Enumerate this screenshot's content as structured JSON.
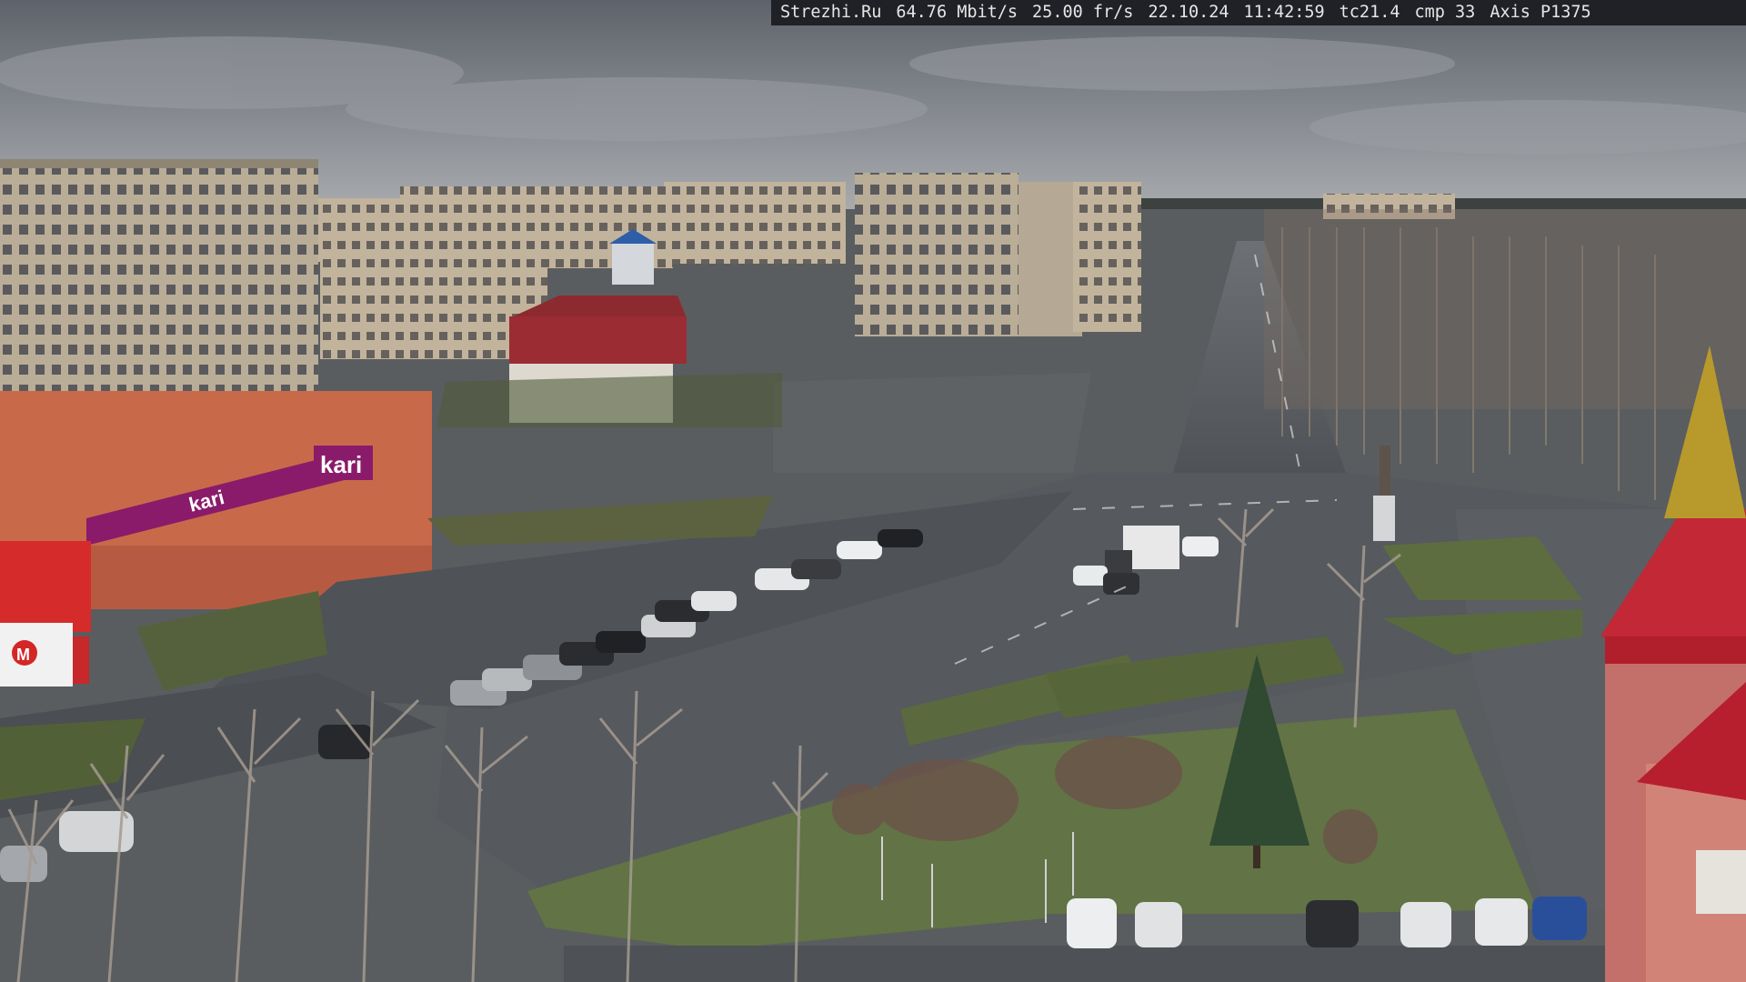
{
  "overlay": {
    "site": "Strezhi.Ru",
    "bitrate": "64.76 Mbit/s",
    "framerate": "25.00 fr/s",
    "date": "22.10.24",
    "time": "11:42:59",
    "tc": "tc21.4",
    "cmp": "cmp 33",
    "camera_model": "Axis P1375"
  },
  "signs": {
    "kari_main": "kari",
    "kari_secondary": "kari",
    "magnit_truck": "M"
  },
  "colors": {
    "sky": "#7a7f86",
    "asphalt": "#55585c",
    "grass": "#5e6b3c",
    "kari_purple": "#8a1b6a",
    "building_panel": "#b9ac95",
    "building_red": "#b5383a"
  }
}
